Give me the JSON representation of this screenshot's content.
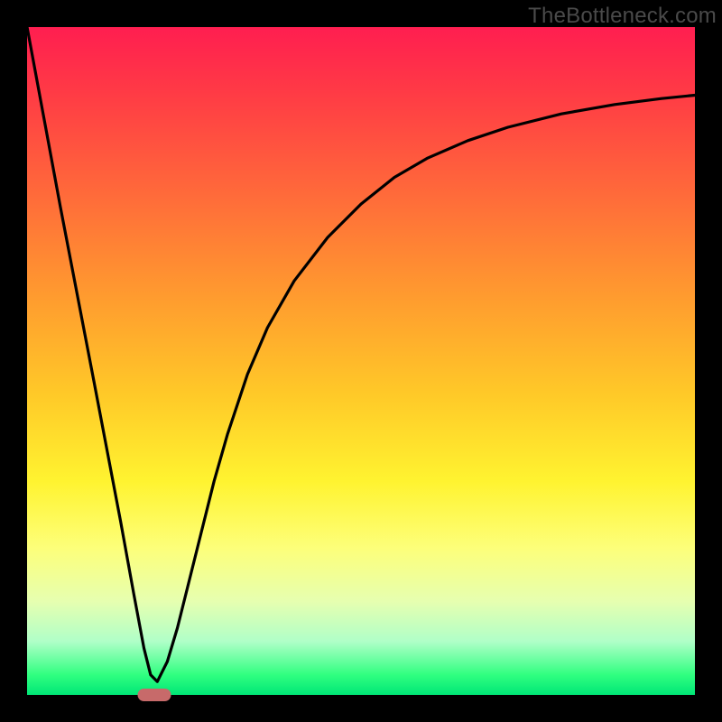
{
  "watermark": "TheBottleneck.com",
  "chart_data": {
    "type": "line",
    "title": "",
    "xlabel": "",
    "ylabel": "",
    "xlim": [
      0,
      100
    ],
    "ylim": [
      0,
      100
    ],
    "grid": false,
    "legend": false,
    "marker": {
      "x": 19,
      "y": 0,
      "width_pct": 5
    },
    "series": [
      {
        "name": "curve",
        "color": "#000000",
        "x": [
          0,
          5,
          10,
          14,
          16,
          17.5,
          18.5,
          19.5,
          21,
          22.5,
          24,
          26,
          28,
          30,
          33,
          36,
          40,
          45,
          50,
          55,
          60,
          66,
          72,
          80,
          88,
          95,
          100
        ],
        "y": [
          100,
          73,
          47,
          26,
          15,
          7,
          3,
          2,
          5,
          10,
          16,
          24,
          32,
          39,
          48,
          55,
          62,
          68.5,
          73.5,
          77.5,
          80.4,
          83,
          85,
          87,
          88.4,
          89.3,
          89.8
        ]
      }
    ],
    "background_gradient": {
      "direction": "vertical",
      "stops": [
        {
          "pos": 0,
          "color": "#ff1e50"
        },
        {
          "pos": 10,
          "color": "#ff3b45"
        },
        {
          "pos": 25,
          "color": "#ff6a3a"
        },
        {
          "pos": 40,
          "color": "#ff9a2f"
        },
        {
          "pos": 55,
          "color": "#ffc928"
        },
        {
          "pos": 68,
          "color": "#fff330"
        },
        {
          "pos": 78,
          "color": "#fdff7a"
        },
        {
          "pos": 86,
          "color": "#e6ffb0"
        },
        {
          "pos": 92,
          "color": "#b0ffc8"
        },
        {
          "pos": 97,
          "color": "#30ff80"
        },
        {
          "pos": 100,
          "color": "#00e676"
        }
      ]
    }
  }
}
